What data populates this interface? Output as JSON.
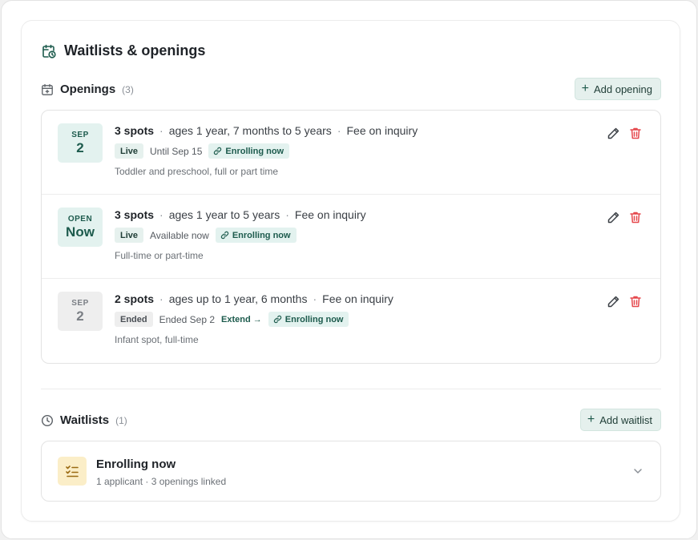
{
  "header": {
    "title": "Waitlists & openings",
    "icon": "calendar-clock-icon"
  },
  "openings": {
    "label": "Openings",
    "count": "(3)",
    "add_label": "Add opening",
    "items": [
      {
        "date_month": "SEP",
        "date_day": "2",
        "date_style": "active",
        "spots": "3 spots",
        "ages": "ages 1 year, 7 months to 5 years",
        "fee": "Fee on inquiry",
        "status": "Live",
        "when": "Until Sep 15",
        "extend": "",
        "link_label": "Enrolling now",
        "note": "Toddler and preschool, full or part time"
      },
      {
        "date_month": "OPEN",
        "date_day": "Now",
        "date_style": "active",
        "spots": "3 spots",
        "ages": "ages 1 year to 5 years",
        "fee": "Fee on inquiry",
        "status": "Live",
        "when": "Available now",
        "extend": "",
        "link_label": "Enrolling now",
        "note": "Full-time or part-time"
      },
      {
        "date_month": "SEP",
        "date_day": "2",
        "date_style": "ended",
        "spots": "2 spots",
        "ages": "ages up to 1 year, 6 months",
        "fee": "Fee on inquiry",
        "status": "Ended",
        "when": "Ended Sep 2",
        "extend": "Extend →",
        "link_label": "Enrolling now",
        "note": "Infant spot, full-time"
      }
    ]
  },
  "waitlists": {
    "label": "Waitlists",
    "count": "(1)",
    "add_label": "Add waitlist",
    "items": [
      {
        "title": "Enrolling now",
        "subtitle": "1 applicant · 3 openings linked"
      }
    ]
  },
  "separator": "·",
  "colors": {
    "accent": "#1d5b4d",
    "accent_bg": "#e3f2ef",
    "danger": "#e5484d",
    "waitlist_icon_bg": "#fbeec8"
  }
}
